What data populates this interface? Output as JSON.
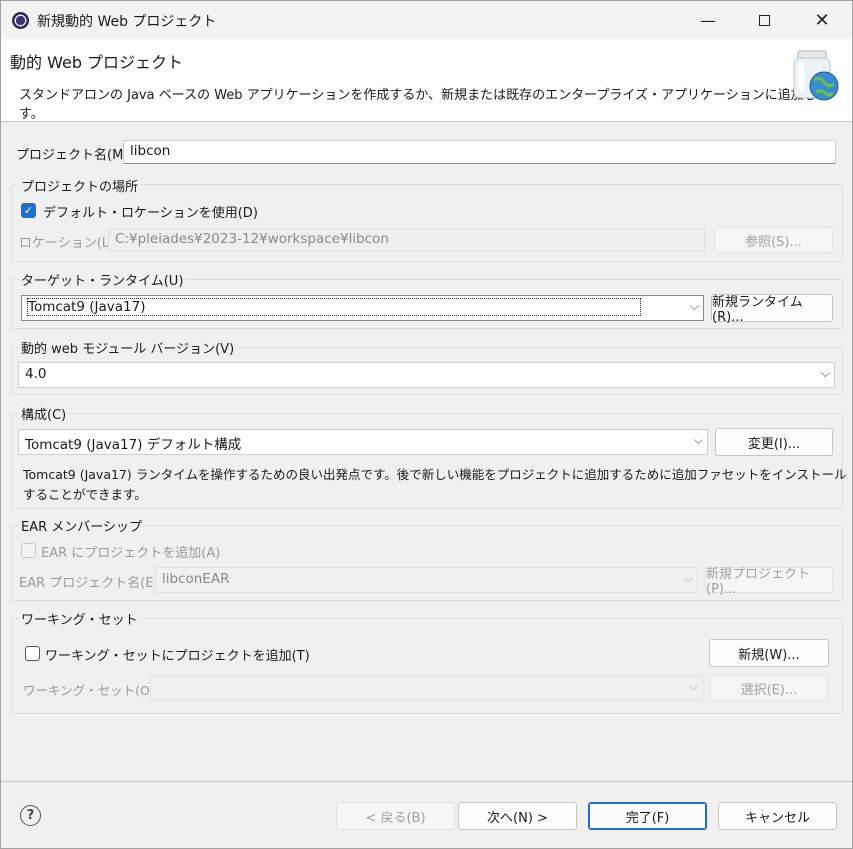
{
  "window": {
    "title": "新規動的 Web プロジェクト"
  },
  "banner": {
    "title": "動的 Web プロジェクト",
    "description": "スタンドアロンの Java ベースの Web アプリケーションを作成するか、新規または既存のエンタープライズ・アプリケーションに追加します。"
  },
  "project_name": {
    "label": "プロジェクト名(M):",
    "value": "libcon"
  },
  "location": {
    "group_label": "プロジェクトの場所",
    "default_checkbox_label": "デフォルト・ロケーションを使用(D)",
    "location_label": "ロケーション(L):",
    "location_value": "C:¥pleiades¥2023-12¥workspace¥libcon",
    "browse_label": "参照(S)..."
  },
  "runtime": {
    "group_label": "ターゲット・ランタイム(U)",
    "selected": "Tomcat9 (Java17)",
    "new_button": "新規ランタイム(R)..."
  },
  "module": {
    "group_label": "動的 web モジュール バージョン(V)",
    "selected": "4.0"
  },
  "config": {
    "group_label": "構成(C)",
    "selected": "Tomcat9 (Java17) デフォルト構成",
    "modify_button": "変更(I)...",
    "description_line1": "Tomcat9 (Java17) ランタイムを操作するための良い出発点です。後で新しい機能をプロジェクトに追加するために追加ファセットをインストール",
    "description_line2": "することができます。"
  },
  "ear": {
    "group_label": "EAR メンバーシップ",
    "checkbox_label": "EAR にプロジェクトを追加(A)",
    "name_label": "EAR プロジェクト名(E):",
    "name_value": "libconEAR",
    "new_button": "新規プロジェクト(P)..."
  },
  "working_set": {
    "group_label": "ワーキング・セット",
    "checkbox_label": "ワーキング・セットにプロジェクトを追加(T)",
    "new_button": "新規(W)...",
    "set_label": "ワーキング・セット(O):",
    "select_button": "選択(E)..."
  },
  "footer": {
    "back_button": "< 戻る(B)",
    "next_button": "次へ(N) >",
    "finish_button": "完了(F)",
    "cancel_button": "キャンセル"
  },
  "icons": {
    "app": "eclipse-icon",
    "minimize": "minimize-icon",
    "maximize": "maximize-icon",
    "close": "close-icon",
    "banner": "web-project-jar-globe-icon",
    "help": "help-icon"
  },
  "colors": {
    "accent": "#1f6fd1"
  }
}
